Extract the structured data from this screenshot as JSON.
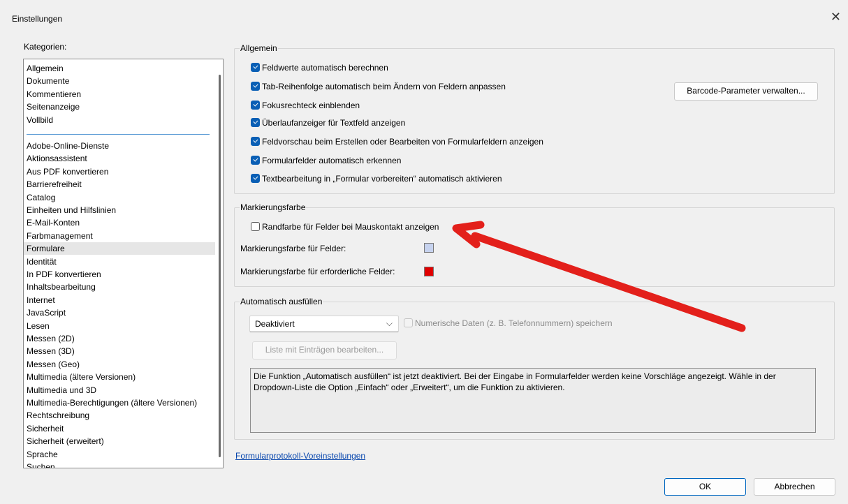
{
  "window": {
    "title": "Einstellungen",
    "close_glyph": "✕"
  },
  "categories": {
    "label": "Kategorien:",
    "top_items": [
      "Allgemein",
      "Dokumente",
      "Kommentieren",
      "Seitenanzeige",
      "Vollbild"
    ],
    "items": [
      "Adobe-Online-Dienste",
      "Aktionsassistent",
      "Aus PDF konvertieren",
      "Barrierefreiheit",
      "Catalog",
      "Einheiten und Hilfslinien",
      "E-Mail-Konten",
      "Farbmanagement",
      "Formulare",
      "Identität",
      "In PDF konvertieren",
      "Inhaltsbearbeitung",
      "Internet",
      "JavaScript",
      "Lesen",
      "Messen (2D)",
      "Messen (3D)",
      "Messen (Geo)",
      "Multimedia (ältere Versionen)",
      "Multimedia und 3D",
      "Multimedia-Berechtigungen (ältere Versionen)",
      "Rechtschreibung",
      "Sicherheit",
      "Sicherheit (erweitert)",
      "Sprache",
      "Suchen"
    ],
    "selected": "Formulare"
  },
  "allgemein": {
    "title": "Allgemein",
    "checkboxes": [
      {
        "label": "Feldwerte automatisch berechnen",
        "checked": true
      },
      {
        "label": "Tab-Reihenfolge automatisch beim Ändern von Feldern anpassen",
        "checked": true
      },
      {
        "label": "Fokusrechteck einblenden",
        "checked": true
      },
      {
        "label": "Überlaufanzeiger für Textfeld anzeigen",
        "checked": true
      },
      {
        "label": "Feldvorschau beim Erstellen oder Bearbeiten von Formularfeldern anzeigen",
        "checked": true
      },
      {
        "label": "Formularfelder automatisch erkennen",
        "checked": true
      },
      {
        "label": "Textbearbeitung in „Formular vorbereiten“ automatisch aktivieren",
        "checked": true
      }
    ],
    "barcode_button": "Barcode-Parameter verwalten..."
  },
  "markierung": {
    "title": "Markierungsfarbe",
    "checkbox": {
      "label": "Randfarbe für Felder bei Mauskontakt anzeigen",
      "checked": false
    },
    "field_color_label": "Markierungsfarbe für Felder:",
    "field_color": "#c6d2ee",
    "required_color_label": "Markierungsfarbe für erforderliche Felder:",
    "required_color": "#e00000"
  },
  "autofill": {
    "title": "Automatisch ausfüllen",
    "dropdown_value": "Deaktiviert",
    "numeric_label": "Numerische Daten (z. B. Telefonnummern) speichern",
    "edit_button": "Liste mit Einträgen bearbeiten...",
    "info_text": "Die Funktion „Automatisch ausfüllen“ ist jetzt deaktiviert. Bei der Eingabe in Formularfelder werden keine Vorschläge angezeigt. Wähle in der Dropdown-Liste die Option „Einfach“ oder „Erweitert“, um die Funktion zu aktivieren."
  },
  "link": "Formularprotokoll-Voreinstellungen",
  "footer": {
    "ok": "OK",
    "cancel": "Abbrechen"
  },
  "annotation": {
    "arrow_color": "#e3201b"
  }
}
